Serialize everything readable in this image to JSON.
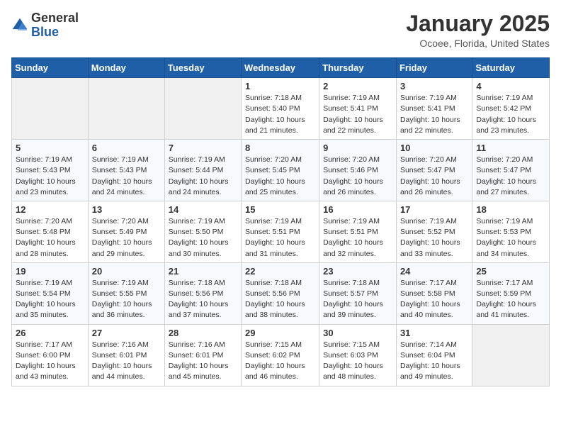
{
  "header": {
    "logo_general": "General",
    "logo_blue": "Blue",
    "month_year": "January 2025",
    "location": "Ocoee, Florida, United States"
  },
  "days_of_week": [
    "Sunday",
    "Monday",
    "Tuesday",
    "Wednesday",
    "Thursday",
    "Friday",
    "Saturday"
  ],
  "weeks": [
    [
      {
        "day": "",
        "sunrise": "",
        "sunset": "",
        "daylight": ""
      },
      {
        "day": "",
        "sunrise": "",
        "sunset": "",
        "daylight": ""
      },
      {
        "day": "",
        "sunrise": "",
        "sunset": "",
        "daylight": ""
      },
      {
        "day": "1",
        "sunrise": "Sunrise: 7:18 AM",
        "sunset": "Sunset: 5:40 PM",
        "daylight": "Daylight: 10 hours and 21 minutes."
      },
      {
        "day": "2",
        "sunrise": "Sunrise: 7:19 AM",
        "sunset": "Sunset: 5:41 PM",
        "daylight": "Daylight: 10 hours and 22 minutes."
      },
      {
        "day": "3",
        "sunrise": "Sunrise: 7:19 AM",
        "sunset": "Sunset: 5:41 PM",
        "daylight": "Daylight: 10 hours and 22 minutes."
      },
      {
        "day": "4",
        "sunrise": "Sunrise: 7:19 AM",
        "sunset": "Sunset: 5:42 PM",
        "daylight": "Daylight: 10 hours and 23 minutes."
      }
    ],
    [
      {
        "day": "5",
        "sunrise": "Sunrise: 7:19 AM",
        "sunset": "Sunset: 5:43 PM",
        "daylight": "Daylight: 10 hours and 23 minutes."
      },
      {
        "day": "6",
        "sunrise": "Sunrise: 7:19 AM",
        "sunset": "Sunset: 5:43 PM",
        "daylight": "Daylight: 10 hours and 24 minutes."
      },
      {
        "day": "7",
        "sunrise": "Sunrise: 7:19 AM",
        "sunset": "Sunset: 5:44 PM",
        "daylight": "Daylight: 10 hours and 24 minutes."
      },
      {
        "day": "8",
        "sunrise": "Sunrise: 7:20 AM",
        "sunset": "Sunset: 5:45 PM",
        "daylight": "Daylight: 10 hours and 25 minutes."
      },
      {
        "day": "9",
        "sunrise": "Sunrise: 7:20 AM",
        "sunset": "Sunset: 5:46 PM",
        "daylight": "Daylight: 10 hours and 26 minutes."
      },
      {
        "day": "10",
        "sunrise": "Sunrise: 7:20 AM",
        "sunset": "Sunset: 5:47 PM",
        "daylight": "Daylight: 10 hours and 26 minutes."
      },
      {
        "day": "11",
        "sunrise": "Sunrise: 7:20 AM",
        "sunset": "Sunset: 5:47 PM",
        "daylight": "Daylight: 10 hours and 27 minutes."
      }
    ],
    [
      {
        "day": "12",
        "sunrise": "Sunrise: 7:20 AM",
        "sunset": "Sunset: 5:48 PM",
        "daylight": "Daylight: 10 hours and 28 minutes."
      },
      {
        "day": "13",
        "sunrise": "Sunrise: 7:20 AM",
        "sunset": "Sunset: 5:49 PM",
        "daylight": "Daylight: 10 hours and 29 minutes."
      },
      {
        "day": "14",
        "sunrise": "Sunrise: 7:19 AM",
        "sunset": "Sunset: 5:50 PM",
        "daylight": "Daylight: 10 hours and 30 minutes."
      },
      {
        "day": "15",
        "sunrise": "Sunrise: 7:19 AM",
        "sunset": "Sunset: 5:51 PM",
        "daylight": "Daylight: 10 hours and 31 minutes."
      },
      {
        "day": "16",
        "sunrise": "Sunrise: 7:19 AM",
        "sunset": "Sunset: 5:51 PM",
        "daylight": "Daylight: 10 hours and 32 minutes."
      },
      {
        "day": "17",
        "sunrise": "Sunrise: 7:19 AM",
        "sunset": "Sunset: 5:52 PM",
        "daylight": "Daylight: 10 hours and 33 minutes."
      },
      {
        "day": "18",
        "sunrise": "Sunrise: 7:19 AM",
        "sunset": "Sunset: 5:53 PM",
        "daylight": "Daylight: 10 hours and 34 minutes."
      }
    ],
    [
      {
        "day": "19",
        "sunrise": "Sunrise: 7:19 AM",
        "sunset": "Sunset: 5:54 PM",
        "daylight": "Daylight: 10 hours and 35 minutes."
      },
      {
        "day": "20",
        "sunrise": "Sunrise: 7:19 AM",
        "sunset": "Sunset: 5:55 PM",
        "daylight": "Daylight: 10 hours and 36 minutes."
      },
      {
        "day": "21",
        "sunrise": "Sunrise: 7:18 AM",
        "sunset": "Sunset: 5:56 PM",
        "daylight": "Daylight: 10 hours and 37 minutes."
      },
      {
        "day": "22",
        "sunrise": "Sunrise: 7:18 AM",
        "sunset": "Sunset: 5:56 PM",
        "daylight": "Daylight: 10 hours and 38 minutes."
      },
      {
        "day": "23",
        "sunrise": "Sunrise: 7:18 AM",
        "sunset": "Sunset: 5:57 PM",
        "daylight": "Daylight: 10 hours and 39 minutes."
      },
      {
        "day": "24",
        "sunrise": "Sunrise: 7:17 AM",
        "sunset": "Sunset: 5:58 PM",
        "daylight": "Daylight: 10 hours and 40 minutes."
      },
      {
        "day": "25",
        "sunrise": "Sunrise: 7:17 AM",
        "sunset": "Sunset: 5:59 PM",
        "daylight": "Daylight: 10 hours and 41 minutes."
      }
    ],
    [
      {
        "day": "26",
        "sunrise": "Sunrise: 7:17 AM",
        "sunset": "Sunset: 6:00 PM",
        "daylight": "Daylight: 10 hours and 43 minutes."
      },
      {
        "day": "27",
        "sunrise": "Sunrise: 7:16 AM",
        "sunset": "Sunset: 6:01 PM",
        "daylight": "Daylight: 10 hours and 44 minutes."
      },
      {
        "day": "28",
        "sunrise": "Sunrise: 7:16 AM",
        "sunset": "Sunset: 6:01 PM",
        "daylight": "Daylight: 10 hours and 45 minutes."
      },
      {
        "day": "29",
        "sunrise": "Sunrise: 7:15 AM",
        "sunset": "Sunset: 6:02 PM",
        "daylight": "Daylight: 10 hours and 46 minutes."
      },
      {
        "day": "30",
        "sunrise": "Sunrise: 7:15 AM",
        "sunset": "Sunset: 6:03 PM",
        "daylight": "Daylight: 10 hours and 48 minutes."
      },
      {
        "day": "31",
        "sunrise": "Sunrise: 7:14 AM",
        "sunset": "Sunset: 6:04 PM",
        "daylight": "Daylight: 10 hours and 49 minutes."
      },
      {
        "day": "",
        "sunrise": "",
        "sunset": "",
        "daylight": ""
      }
    ]
  ]
}
